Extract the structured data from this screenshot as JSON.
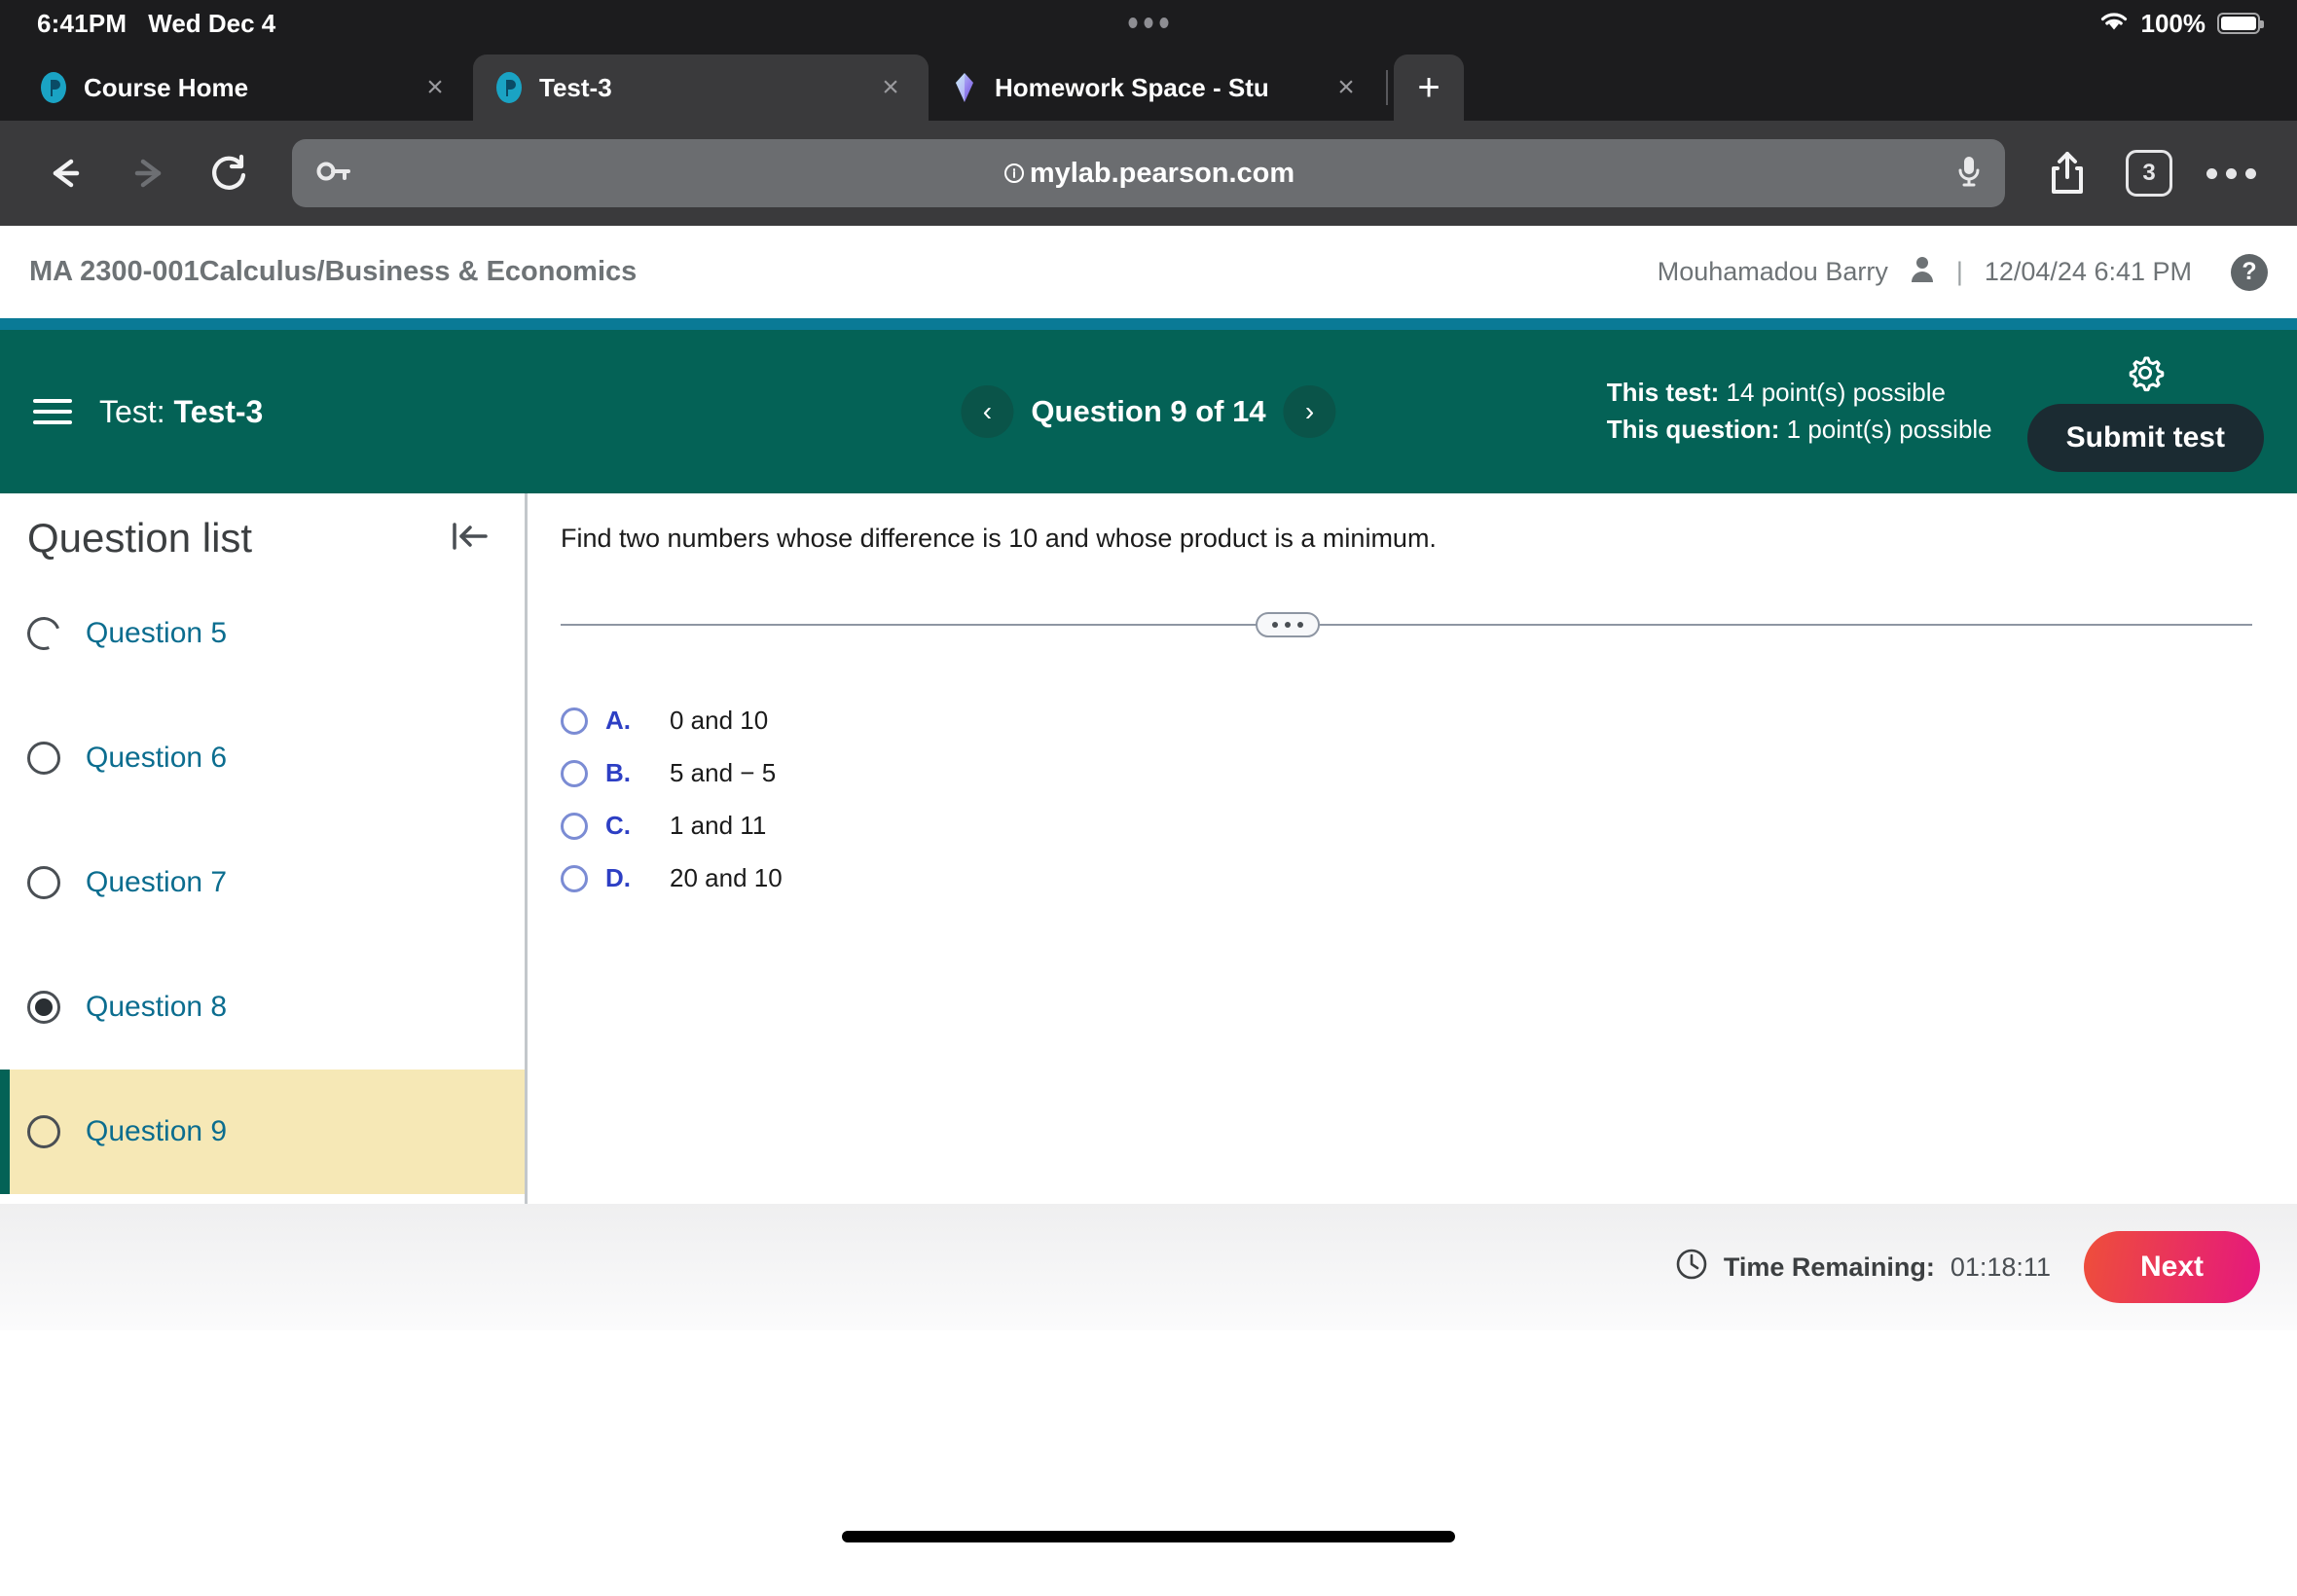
{
  "status_bar": {
    "time": "6:41PM",
    "date": "Wed Dec 4",
    "battery_percent": "100%",
    "wifi_icon": "wifi-icon",
    "battery_icon": "battery-full-icon",
    "dots_icon": "multitask-dots-icon"
  },
  "browser": {
    "tabs": [
      {
        "title": "Course Home",
        "favicon": "pearson-p-icon",
        "active": false,
        "close_label": "×"
      },
      {
        "title": "Test-3",
        "favicon": "pearson-p-icon",
        "active": true,
        "close_label": "×"
      },
      {
        "title": "Homework Space - Stu",
        "favicon": "gem-icon",
        "active": false,
        "close_label": "×"
      }
    ],
    "new_tab_label": "+",
    "back_icon": "back-arrow-icon",
    "forward_icon": "forward-arrow-icon",
    "reload_icon": "reload-icon",
    "password_icon": "key-icon",
    "microphone_icon": "microphone-icon",
    "share_icon": "share-icon",
    "more_icon": "more-ellipsis-icon",
    "url": "mylab.pearson.com",
    "url_prefix_icon": "page-settings-icon",
    "tab_count": "3"
  },
  "course_header": {
    "title": "MA 2300-001Calculus/Business & Economics",
    "user_name": "Mouhamadou Barry",
    "user_icon": "person-icon",
    "separator": "|",
    "timestamp": "12/04/24 6:41 PM",
    "help_label": "?"
  },
  "test_bar": {
    "menu_icon": "hamburger-menu-icon",
    "test_prefix": "Test:",
    "test_name": "Test-3",
    "prev_label": "‹",
    "next_label": "›",
    "question_position": "Question 9 of 14",
    "this_test_label": "This test:",
    "this_test_value": "14 point(s) possible",
    "this_question_label": "This question:",
    "this_question_value": "1 point(s) possible",
    "settings_icon": "gear-icon",
    "submit_label": "Submit test"
  },
  "sidebar": {
    "title": "Question list",
    "collapse_icon": "collapse-panel-left-icon",
    "items": [
      {
        "label": "Question 5",
        "state": "partial"
      },
      {
        "label": "Question 6",
        "state": "empty"
      },
      {
        "label": "Question 7",
        "state": "empty"
      },
      {
        "label": "Question 8",
        "state": "answered"
      },
      {
        "label": "Question 9",
        "state": "empty",
        "current": true
      }
    ]
  },
  "question": {
    "prompt": "Find two numbers whose difference is 10 and whose product is a minimum.",
    "drag_handle_icon": "drag-handle-dots-icon",
    "options": [
      {
        "letter": "A.",
        "text": "0 and 10",
        "selected": false
      },
      {
        "letter": "B.",
        "text": "5 and − 5",
        "selected": false
      },
      {
        "letter": "C.",
        "text": "1 and 11",
        "selected": false
      },
      {
        "letter": "D.",
        "text": "20 and 10",
        "selected": false
      }
    ]
  },
  "bottom_bar": {
    "clock_icon": "clock-icon",
    "time_label": "Time Remaining:",
    "time_value": "01:18:11",
    "next_label": "Next"
  },
  "colors": {
    "teal": "#046256",
    "teal_accent": "#0a7a96",
    "link_blue": "#0b6d8f",
    "highlight_yellow": "#f6e8b6",
    "option_blue": "#2d3fc4",
    "next_pink": "#e5177e"
  }
}
